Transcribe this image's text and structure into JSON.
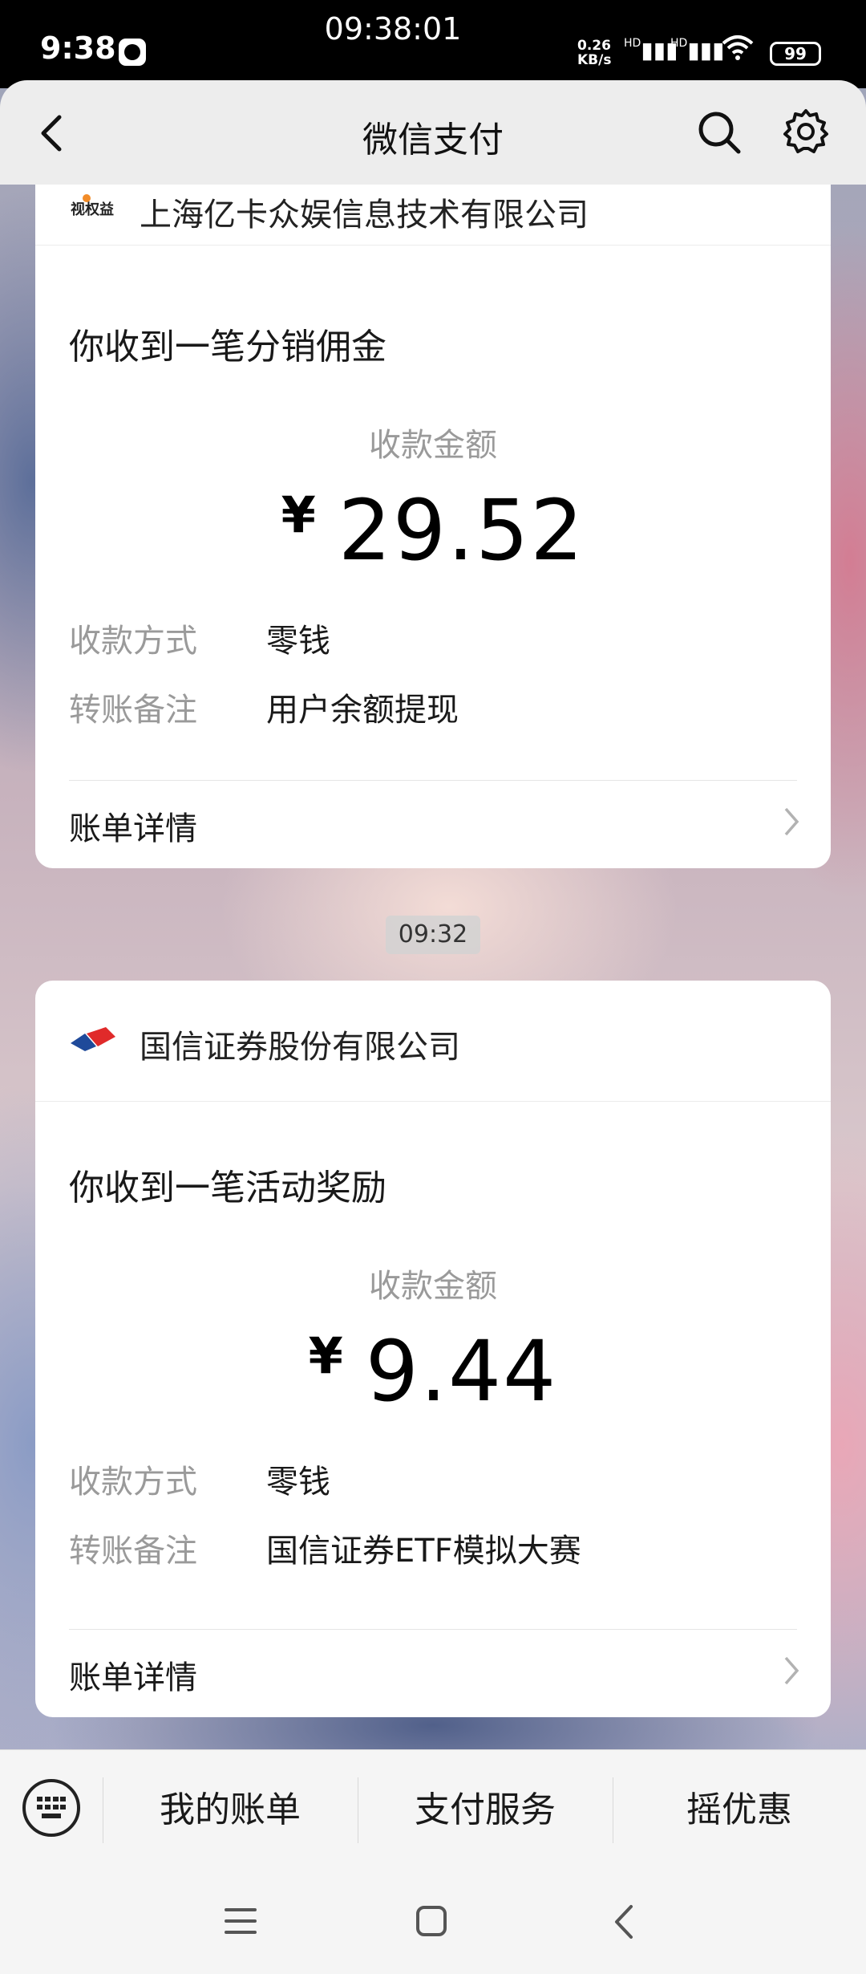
{
  "status_bar": {
    "time": "9:38",
    "center_time": "09:38:01",
    "net_speed_value": "0.26",
    "net_speed_unit": "KB/s",
    "signal1": "HD",
    "signal2": "HD",
    "battery": "99"
  },
  "header": {
    "title": "微信支付"
  },
  "cards": [
    {
      "merchant": "上海亿卡众娱信息技术有限公司",
      "logo_text": "视权益",
      "heading": "你收到一笔分销佣金",
      "amount_label": "收款金额",
      "currency": "¥",
      "amount": "29.52",
      "method_label": "收款方式",
      "method_value": "零钱",
      "note_label": "转账备注",
      "note_value": "用户余额提现",
      "detail_label": "账单详情"
    },
    {
      "merchant": "国信证券股份有限公司",
      "heading": "你收到一笔活动奖励",
      "amount_label": "收款金额",
      "currency": "¥",
      "amount": "9.44",
      "method_label": "收款方式",
      "method_value": "零钱",
      "note_label": "转账备注",
      "note_value": "国信证券ETF模拟大赛",
      "detail_label": "账单详情"
    }
  ],
  "timestamp": "09:32",
  "menu": {
    "items": [
      "我的账单",
      "支付服务",
      "摇优惠"
    ]
  },
  "colors": {
    "header_bg": "#ededed",
    "card_bg": "#ffffff",
    "muted_text": "#9a9a9a"
  }
}
